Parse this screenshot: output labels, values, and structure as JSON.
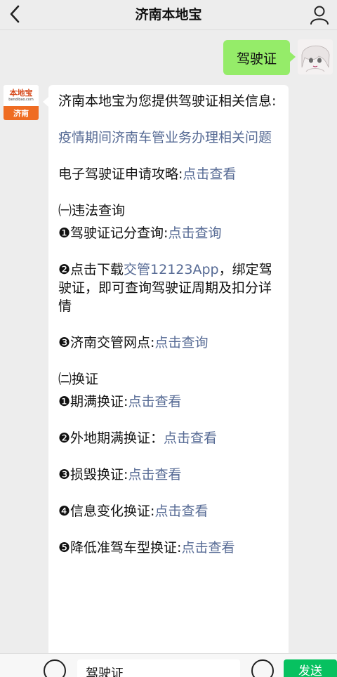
{
  "header": {
    "title": "济南本地宝"
  },
  "user_message": "驾驶证",
  "bot": {
    "avatar_brand": "本地宝",
    "avatar_domain": "bendibao.com",
    "avatar_city": "济南",
    "intro": "济南本地宝为您提供驾驶证相关信息:",
    "link_epidemic": "疫情期间济南车管业务办理相关问题",
    "e_license_label": "电子驾驶证申请攻略:",
    "e_license_link": "点击查看",
    "section1_title": "㈠违法查询",
    "item1_prefix": "❶驾驶证记分查询:",
    "item1_link": "点击查询",
    "item2_prefix": "❷点击下载",
    "item2_link": "交管12123App",
    "item2_suffix": "，绑定驾驶证，即可查询驾驶证周期及扣分详情",
    "item3_prefix": "❸济南交管网点:",
    "item3_link": "点击查询",
    "section2_title": "㈡换证",
    "renew1_prefix": "❶期满换证:",
    "renew1_link": "点击查看",
    "renew2_prefix": "❷外地期满换证：",
    "renew2_link": "点击查看",
    "renew3_prefix": "❸损毁换证:",
    "renew3_link": "点击查看",
    "renew4_prefix": "❹信息变化换证:",
    "renew4_link": "点击查看",
    "renew5_prefix": "❺降低准驾车型换证:",
    "renew5_link": "点击查看"
  },
  "input_bar": {
    "value": "驾驶证",
    "send_label": "发送"
  },
  "colors": {
    "user_bubble": "#95ec69",
    "link": "#576b95",
    "send": "#07c160"
  }
}
